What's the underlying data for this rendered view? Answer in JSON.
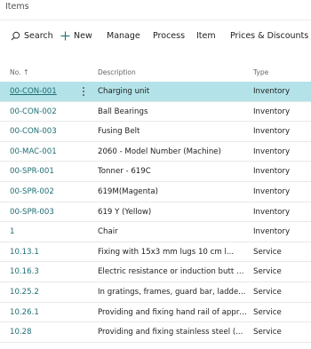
{
  "page": {
    "title": "Items"
  },
  "actions": {
    "search": "Search",
    "new": "New",
    "manage": "Manage",
    "process": "Process",
    "item": "Item",
    "prices": "Prices & Discounts"
  },
  "columns": {
    "no": "No.",
    "sort_indicator": "↑",
    "description": "Description",
    "type": "Type"
  },
  "rows": [
    {
      "no": "00-CON-001",
      "description": "Charging unit",
      "type": "Inventory"
    },
    {
      "no": "00-CON-002",
      "description": "Ball Bearings",
      "type": "Inventory"
    },
    {
      "no": "00-CON-003",
      "description": "Fusing Belt",
      "type": "Inventory"
    },
    {
      "no": "00-MAC-001",
      "description": "2060 - Model Number (Machine)",
      "type": "Inventory"
    },
    {
      "no": "00-SPR-001",
      "description": "Tonner - 619C",
      "type": "Inventory"
    },
    {
      "no": "00-SPR-002",
      "description": "619M(Magenta)",
      "type": "Inventory"
    },
    {
      "no": "00-SPR-003",
      "description": "619 Y (Yellow)",
      "type": "Inventory"
    },
    {
      "no": "1",
      "description": "Chair",
      "type": "Inventory"
    },
    {
      "no": "10.13.1",
      "description": "Fixing  with  15x3  mm  lugs  10  cm  l...",
      "type": "Service"
    },
    {
      "no": "10.16.3",
      "description": "Electric resistance or induction butt wel...",
      "type": "Service"
    },
    {
      "no": "10.25.2",
      "description": "In  gratings,  frames,  guard  bar,  ladde...",
      "type": "Service"
    },
    {
      "no": "10.26.1",
      "description": "Providing and fixing hand rail of appro...",
      "type": "Service"
    },
    {
      "no": "10.28",
      "description": "Providing  and  fixing  stainless  steel  (...",
      "type": "Service"
    }
  ]
}
